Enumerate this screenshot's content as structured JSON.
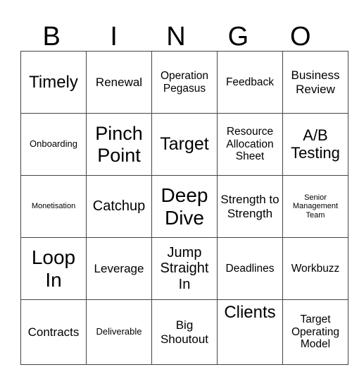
{
  "header": {
    "letters": [
      "B",
      "I",
      "N",
      "G",
      "O"
    ]
  },
  "board": {
    "rows": [
      [
        "Timely",
        "Renewal",
        "Operation Pegasus",
        "Feedback",
        "Business Review"
      ],
      [
        "Onboarding",
        "Pinch Point",
        "Target",
        "Resource Allocation Sheet",
        "A/B Testing"
      ],
      [
        "Monetisation",
        "Catchup",
        "Deep Dive",
        "Strength to Strength",
        "Senior Management Team"
      ],
      [
        "Loop In",
        "Leverage",
        "Jump Straight In",
        "Deadlines",
        "Workbuzz"
      ],
      [
        "Contracts",
        "Deliverable",
        "Big Shoutout",
        "Clients",
        "Target Operating Model"
      ]
    ]
  }
}
